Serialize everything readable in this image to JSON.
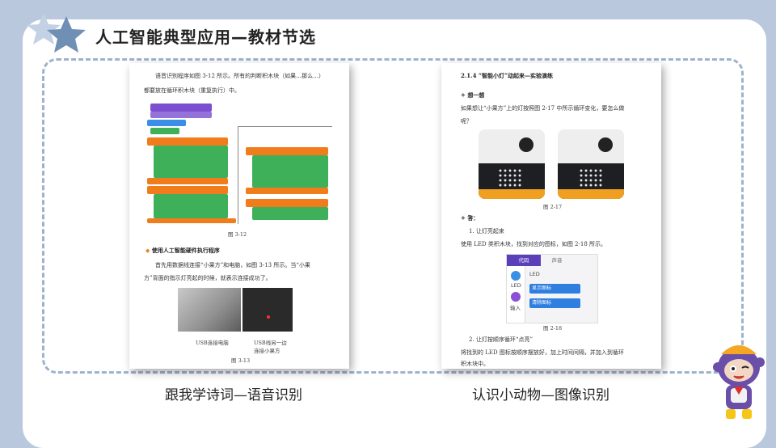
{
  "header": {
    "title": "人工智能典型应用—教材节选"
  },
  "left_page": {
    "para1": "语音识别程序如图 3-12 所示。所有的判断积木块（如果…那么…）",
    "para2": "都要放在循环积木块（重复执行）中。",
    "fig1_caption": "图 3-12",
    "section_heading": "使用人工智能硬件执行程序",
    "para3": "首先用数据线连接“小果方”和电脑，如图 3-13 所示。当“小果",
    "para4": "方”背面的指示灯亮起的时候，就表示连接成功了。",
    "photo_label_left": "USB连接电脑",
    "photo_label_right_1": "USB线另一边",
    "photo_label_right_2": "连接小果方",
    "fig2_caption": "图 3-13"
  },
  "right_page": {
    "heading": "2.1.4 “智能小灯”动起来—实验演练",
    "sub1": "想一想",
    "q1": "如果想让“小果方”上的灯按照图 2-17 中所示循环变化，要怎么做",
    "q2": "呢？",
    "fig1_caption": "图 2-17",
    "sub2": "答：",
    "step1": "1. 让灯亮起来",
    "step1_text": "使用 LED 类积木块，找到对应的图标，如图 2-18 所示。",
    "tab_code": "代码",
    "tab_sound": "声音",
    "cat_led": "LED",
    "cat_input": "输入",
    "panel_title": "LED",
    "block1": "显示图标",
    "block2": "清除图标",
    "fig2_caption": "图 2-18",
    "step2": "2. 让灯按顺序循环“点亮”",
    "step2_text1": "将找到的 LED 图标按顺序摆放好，加上时间间隔，并加入到循环",
    "step2_text2": "积木块中。"
  },
  "captions": {
    "left": "跟我学诗词—语音识别",
    "right": "认识小动物—图像识别"
  },
  "colors": {
    "background": "#b9c8dc",
    "star": "#6f8fb5",
    "dash": "#9fb2cc",
    "block_purple": "#7b4fd0",
    "block_orange": "#f07c1c",
    "block_green": "#3fb05a"
  }
}
